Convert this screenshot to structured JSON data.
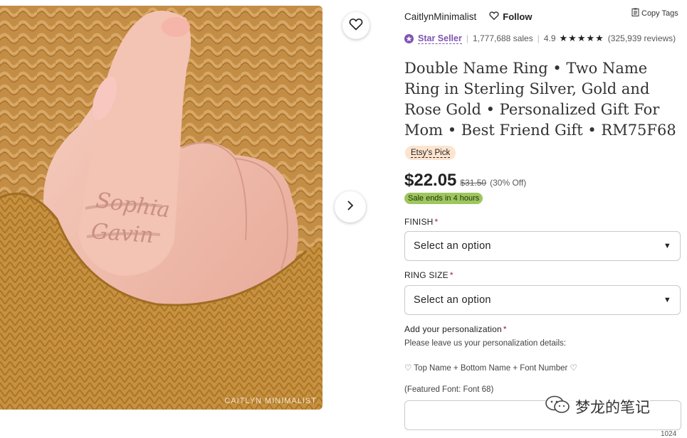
{
  "product_image": {
    "watermark": "CAITLYN MINIMALIST",
    "ring_names": [
      "Sophia",
      "Gavin"
    ]
  },
  "seller": {
    "shop_name": "CaitlynMinimalist",
    "follow_label": "Follow",
    "copy_tags_label": "Copy Tags"
  },
  "stats": {
    "star_seller_label": "Star Seller",
    "sales": "1,777,688 sales",
    "rating": "4.9",
    "stars": "★★★★★",
    "reviews": "(325,939 reviews)"
  },
  "title": "Double Name Ring • Two Name Ring in Sterling Silver, Gold and Rose Gold • Personalized Gift For Mom • Best Friend Gift • RM75F68",
  "badge": {
    "etsy_pick": "Etsy's Pick"
  },
  "price": {
    "current": "$22.05",
    "original": "$31.50",
    "discount": "(30% Off)",
    "sale_text": "Sale ends in 4 hours"
  },
  "options": {
    "finish": {
      "label": "FINISH",
      "placeholder": "Select an option"
    },
    "ring_size": {
      "label": "RING SIZE",
      "placeholder": "Select an option"
    }
  },
  "personalization": {
    "label": "Add your personalization",
    "line1": "Please leave us your personalization details:",
    "line2": "♡ Top Name + Bottom Name + Font Number ♡",
    "line3": "(Featured Font: Font 68)",
    "char_count": "1024"
  },
  "overlay": {
    "wechat_watermark": "梦龙的笔记"
  },
  "colors": {
    "star_seller": "#7f54b3",
    "sale_badge": "#9ec65f",
    "etsy_pick_bg": "#fde4cf",
    "required": "#a61a2e"
  }
}
